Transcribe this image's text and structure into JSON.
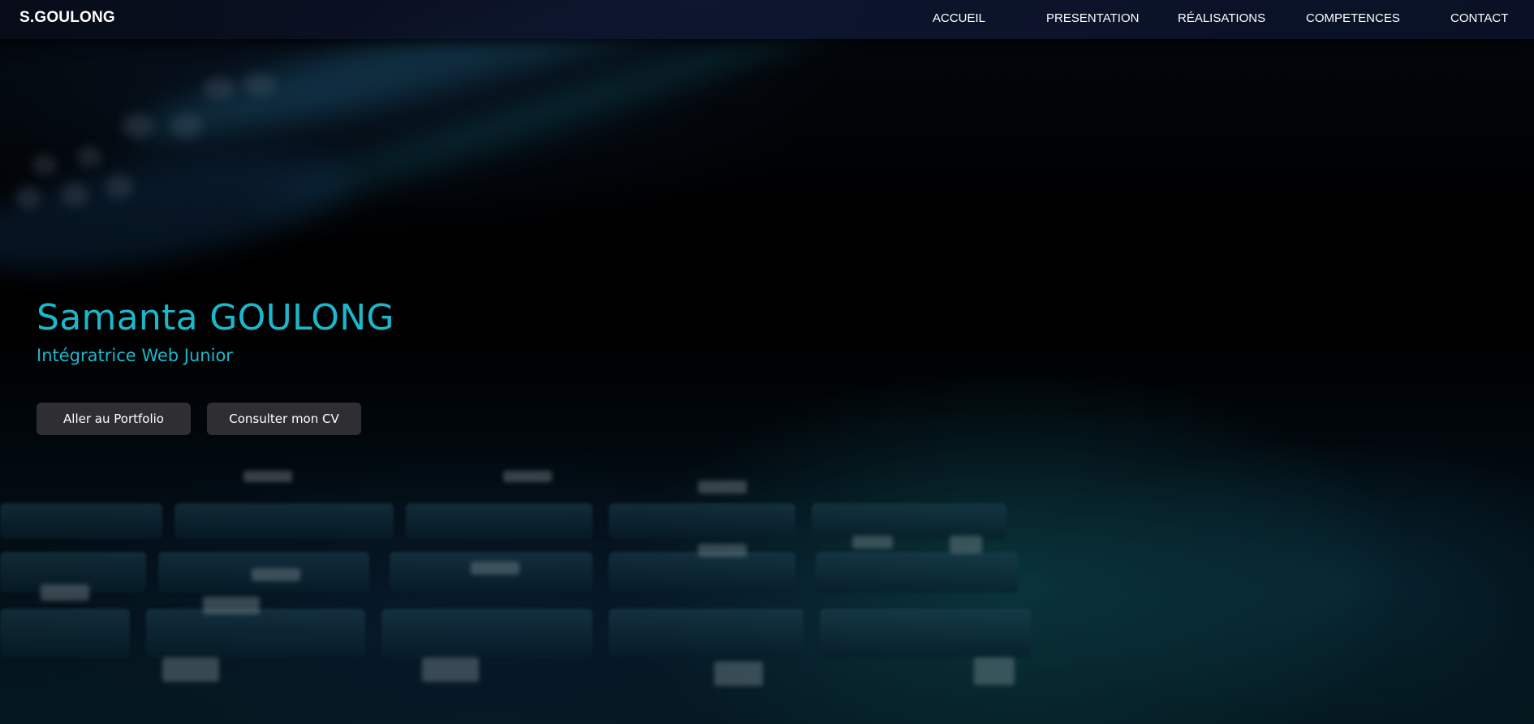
{
  "navbar": {
    "brand": "S.GOULONG",
    "links": [
      {
        "label": "ACCUEIL"
      },
      {
        "label": "PRESENTATION"
      },
      {
        "label": "RÉALISATIONS"
      },
      {
        "label": "COMPETENCES"
      },
      {
        "label": "CONTACT"
      }
    ]
  },
  "hero": {
    "title": "Samanta GOULONG",
    "subtitle": "Intégratrice Web Junior",
    "buttons": [
      {
        "label": "Aller au Portfolio"
      },
      {
        "label": "Consulter mon CV"
      }
    ]
  },
  "colors": {
    "accent": "#1bb8cc",
    "button_bg": "#2f2f33",
    "navbar_bg": "#0e1630"
  }
}
